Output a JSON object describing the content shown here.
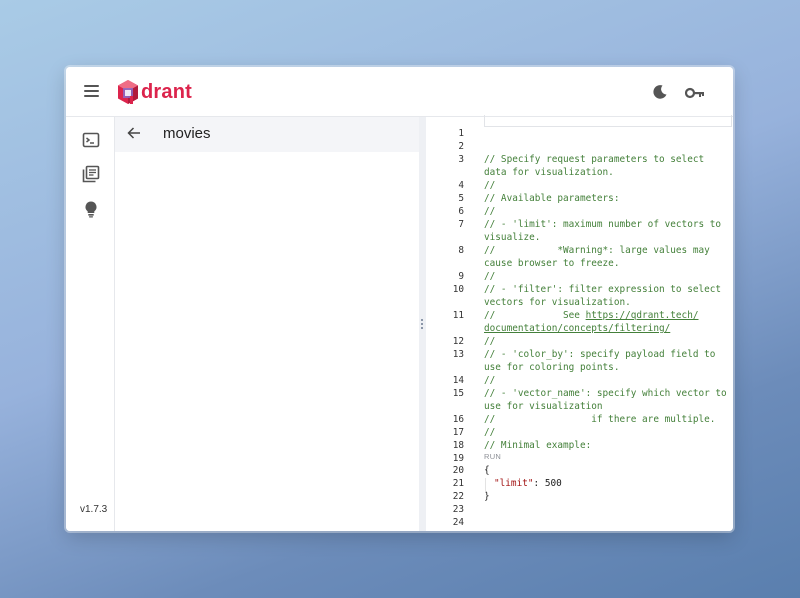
{
  "app": {
    "logo_text": "drant",
    "brand_colors": {
      "primary": "#dc244c",
      "accent": "#8a6bc8"
    }
  },
  "topbar": {
    "menu_icon": "hamburger-menu-icon",
    "theme_icon": "moon-icon",
    "api_key_icon": "key-icon"
  },
  "sidenav": {
    "items": [
      {
        "icon": "console-icon"
      },
      {
        "icon": "collections-icon"
      },
      {
        "icon": "lightbulb-icon"
      }
    ],
    "version": "v1.7.3"
  },
  "collection": {
    "title": "movies",
    "back_icon": "arrow-left-icon"
  },
  "editor": {
    "lines": [
      {
        "n": "1",
        "text": ""
      },
      {
        "n": "2",
        "text": ""
      },
      {
        "n": "3",
        "text": "// Specify request parameters to select",
        "cont": "data for visualization."
      },
      {
        "n": "4",
        "text": "//"
      },
      {
        "n": "5",
        "text": "// Available parameters:"
      },
      {
        "n": "6",
        "text": "//"
      },
      {
        "n": "7",
        "text": "// - 'limit': maximum number of vectors to",
        "cont": "visualize."
      },
      {
        "n": "8",
        "text": "//           *Warning*: large values may",
        "cont": "cause browser to freeze."
      },
      {
        "n": "9",
        "text": "//"
      },
      {
        "n": "10",
        "text": "// - 'filter': filter expression to select",
        "cont": "vectors for visualization."
      },
      {
        "n": "11",
        "text": "//            See ",
        "link": "https://qdrant.tech/",
        "link_cont": "documentation/concepts/filtering/"
      },
      {
        "n": "12",
        "text": "//"
      },
      {
        "n": "13",
        "text": "// - 'color_by': specify payload field to",
        "cont": "use for coloring points."
      },
      {
        "n": "14",
        "text": "//"
      },
      {
        "n": "15",
        "text": "// - 'vector_name': specify which vector to",
        "cont": "use for visualization"
      },
      {
        "n": "16",
        "text": "//                 if there are multiple."
      },
      {
        "n": "17",
        "text": "//"
      },
      {
        "n": "18",
        "text": "// Minimal example:"
      },
      {
        "n": "19",
        "text": ""
      }
    ],
    "run_label": "RUN",
    "json_lines": [
      {
        "n": "20",
        "open": "{"
      },
      {
        "n": "21",
        "key": "\"limit\"",
        "sep": ": ",
        "value": "500"
      },
      {
        "n": "22",
        "close": "}"
      },
      {
        "n": "23"
      },
      {
        "n": "24"
      }
    ]
  }
}
